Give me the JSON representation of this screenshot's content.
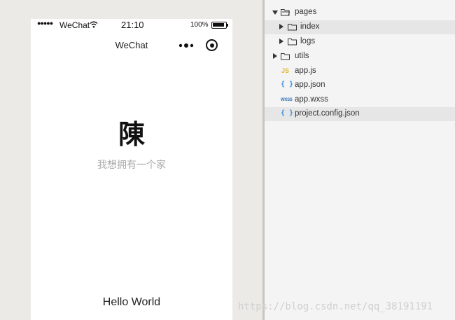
{
  "status_bar": {
    "signal": "●●●●●",
    "carrier": "WeChat",
    "time": "21:10",
    "battery_percent": "100%"
  },
  "nav_bar": {
    "title": "WeChat"
  },
  "page": {
    "avatar_char": "陳",
    "nickname": "我想拥有一个家",
    "motto": "Hello World"
  },
  "file_tree": {
    "pages": "pages",
    "index": "index",
    "logs": "logs",
    "utils": "utils",
    "app_js": "app.js",
    "app_json": "app.json",
    "app_wxss": "app.wxss",
    "project_config": "project.config.json",
    "icons": {
      "js": "JS",
      "json": "{ }",
      "wxss": "WXSS"
    }
  },
  "watermark": "https://blog.csdn.net/qq_38191191"
}
